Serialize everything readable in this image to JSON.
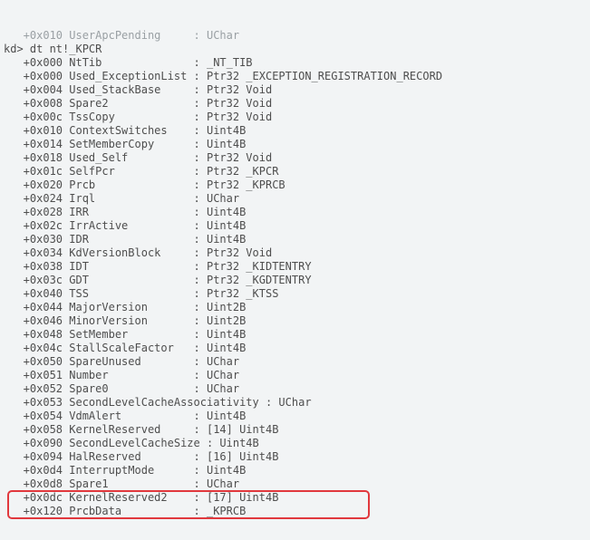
{
  "top_partial": {
    "offset": "+0x010",
    "name": "UserApcPending",
    "type": "UChar"
  },
  "prompt": "kd>",
  "command": "dt nt!_KPCR",
  "rows": [
    {
      "offset": "+0x000",
      "name": "NtTib",
      "type": "_NT_TIB"
    },
    {
      "offset": "+0x000",
      "name": "Used_ExceptionList",
      "type": "Ptr32 _EXCEPTION_REGISTRATION_RECORD"
    },
    {
      "offset": "+0x004",
      "name": "Used_StackBase",
      "type": "Ptr32 Void"
    },
    {
      "offset": "+0x008",
      "name": "Spare2",
      "type": "Ptr32 Void"
    },
    {
      "offset": "+0x00c",
      "name": "TssCopy",
      "type": "Ptr32 Void"
    },
    {
      "offset": "+0x010",
      "name": "ContextSwitches",
      "type": "Uint4B"
    },
    {
      "offset": "+0x014",
      "name": "SetMemberCopy",
      "type": "Uint4B"
    },
    {
      "offset": "+0x018",
      "name": "Used_Self",
      "type": "Ptr32 Void"
    },
    {
      "offset": "+0x01c",
      "name": "SelfPcr",
      "type": "Ptr32 _KPCR"
    },
    {
      "offset": "+0x020",
      "name": "Prcb",
      "type": "Ptr32 _KPRCB"
    },
    {
      "offset": "+0x024",
      "name": "Irql",
      "type": "UChar"
    },
    {
      "offset": "+0x028",
      "name": "IRR",
      "type": "Uint4B"
    },
    {
      "offset": "+0x02c",
      "name": "IrrActive",
      "type": "Uint4B"
    },
    {
      "offset": "+0x030",
      "name": "IDR",
      "type": "Uint4B"
    },
    {
      "offset": "+0x034",
      "name": "KdVersionBlock",
      "type": "Ptr32 Void"
    },
    {
      "offset": "+0x038",
      "name": "IDT",
      "type": "Ptr32 _KIDTENTRY"
    },
    {
      "offset": "+0x03c",
      "name": "GDT",
      "type": "Ptr32 _KGDTENTRY"
    },
    {
      "offset": "+0x040",
      "name": "TSS",
      "type": "Ptr32 _KTSS"
    },
    {
      "offset": "+0x044",
      "name": "MajorVersion",
      "type": "Uint2B"
    },
    {
      "offset": "+0x046",
      "name": "MinorVersion",
      "type": "Uint2B"
    },
    {
      "offset": "+0x048",
      "name": "SetMember",
      "type": "Uint4B"
    },
    {
      "offset": "+0x04c",
      "name": "StallScaleFactor",
      "type": "Uint4B"
    },
    {
      "offset": "+0x050",
      "name": "SpareUnused",
      "type": "UChar"
    },
    {
      "offset": "+0x051",
      "name": "Number",
      "type": "UChar"
    },
    {
      "offset": "+0x052",
      "name": "Spare0",
      "type": "UChar"
    },
    {
      "offset": "+0x053",
      "name": "SecondLevelCacheAssociativity",
      "type": "UChar"
    },
    {
      "offset": "+0x054",
      "name": "VdmAlert",
      "type": "Uint4B"
    },
    {
      "offset": "+0x058",
      "name": "KernelReserved",
      "type": "[14] Uint4B"
    },
    {
      "offset": "+0x090",
      "name": "SecondLevelCacheSize",
      "type": "Uint4B"
    },
    {
      "offset": "+0x094",
      "name": "HalReserved",
      "type": "[16] Uint4B"
    },
    {
      "offset": "+0x0d4",
      "name": "InterruptMode",
      "type": "Uint4B"
    },
    {
      "offset": "+0x0d8",
      "name": "Spare1",
      "type": "UChar"
    },
    {
      "offset": "+0x0dc",
      "name": "KernelReserved2",
      "type": "[17] Uint4B"
    },
    {
      "offset": "+0x120",
      "name": "PrcbData",
      "type": "_KPRCB"
    }
  ],
  "highlight": {
    "from": 32,
    "to": 33
  },
  "name_col": 18,
  "long_name_threshold": 20
}
